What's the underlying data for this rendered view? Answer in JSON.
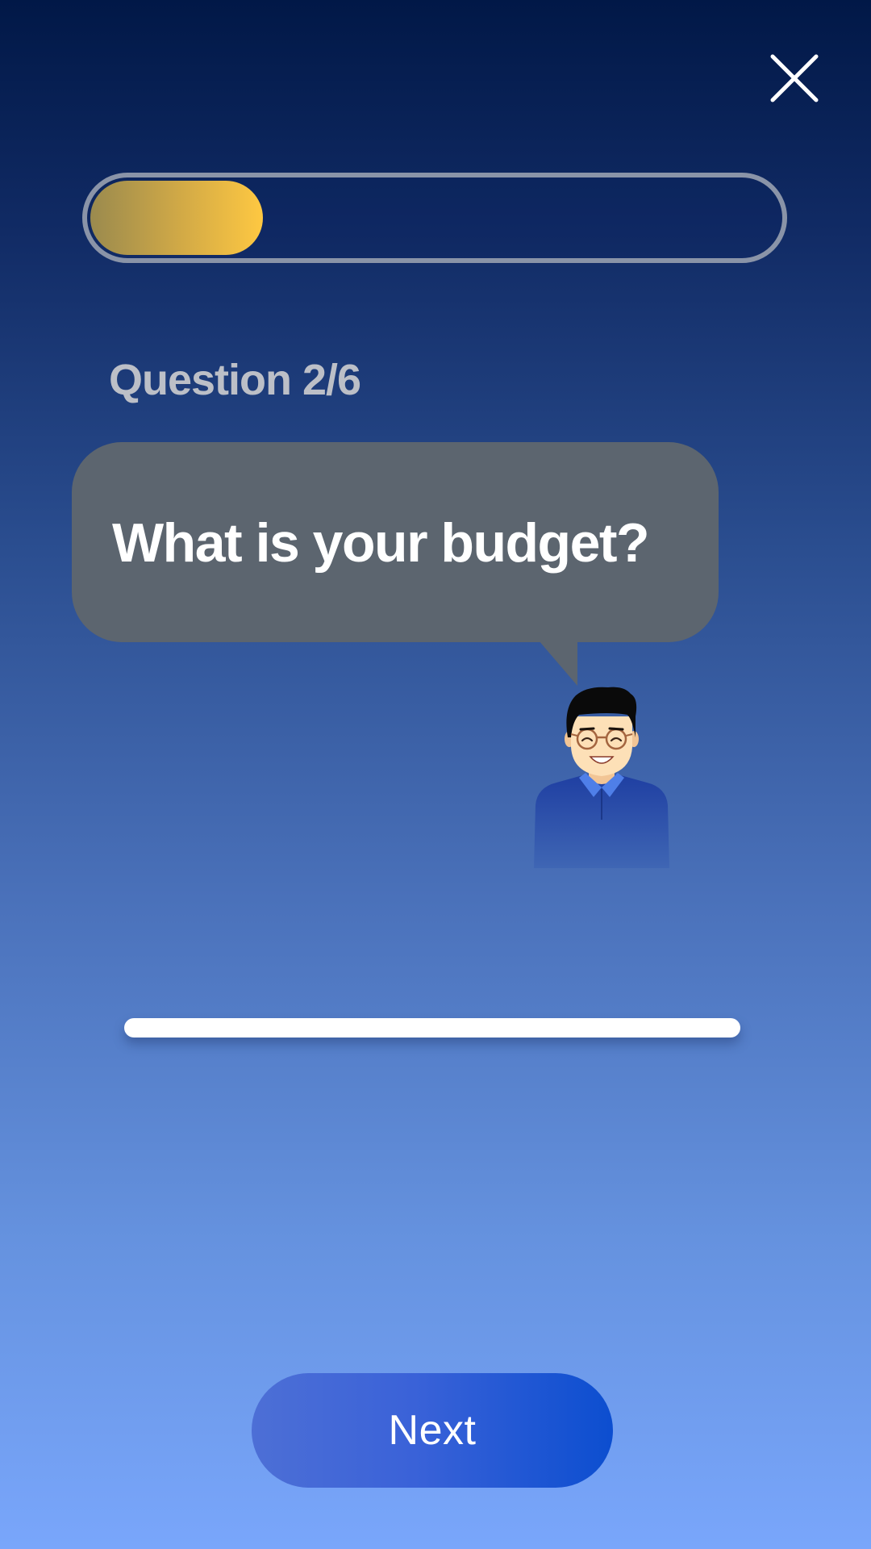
{
  "header": {
    "close_icon": "close-icon"
  },
  "progress": {
    "value": 0.25,
    "fill_color_start": "#9a8a4e",
    "fill_color_end": "#fec842"
  },
  "question": {
    "counter": "Question 2/6",
    "text": "What is your budget?"
  },
  "avatar": {
    "icon": "man-with-glasses-avatar"
  },
  "answer": {
    "value": "",
    "placeholder": ""
  },
  "footer": {
    "next_label": "Next"
  },
  "colors": {
    "bubble": "#5c656f",
    "background_top": "#011847",
    "background_bottom": "#79a6fb",
    "button": "#1f55d6"
  }
}
